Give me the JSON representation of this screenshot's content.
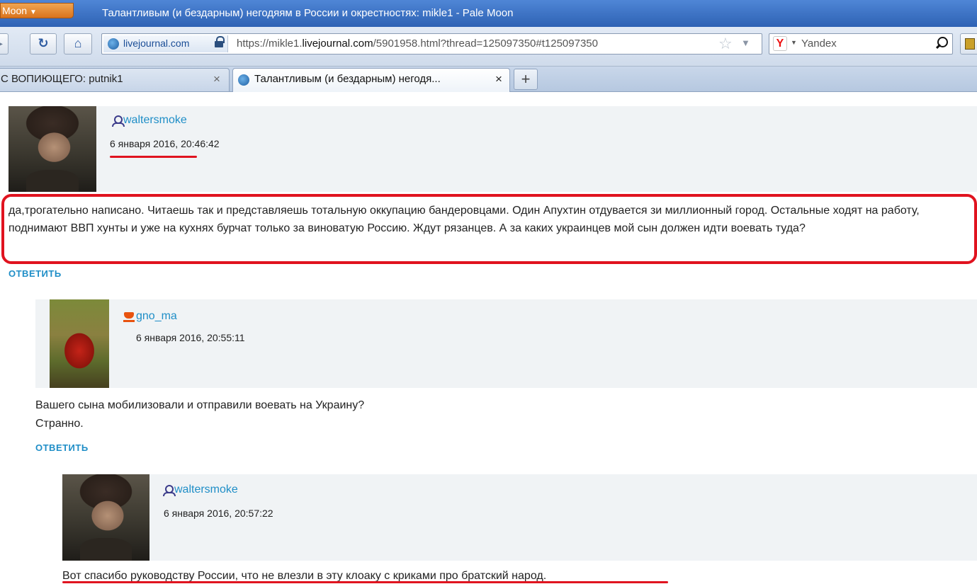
{
  "window": {
    "app_menu_label": "Moon",
    "title": "Талантливым (и бездарным) негодяям в России и окрестностях: mikle1 - Pale Moon"
  },
  "navbar": {
    "site_identity": "livejournal.com",
    "url_prefix": "https://mikle1.",
    "url_domain": "livejournal.com",
    "url_rest": "/5901958.html?thread=125097350#t125097350",
    "search_engine_placeholder": "Yandex"
  },
  "tabs": [
    {
      "label": "С ВОПИЮЩЕГО: putnik1",
      "active": false
    },
    {
      "label": "Талантливым (и бездарным) негодя...",
      "active": true
    }
  ],
  "comments": [
    {
      "username": "waltersmoke",
      "datetime": "6 января 2016, 20:46:42",
      "text": "да,трогательно написано. Читаешь так и представляешь тотальную оккупацию бандеровцами. Один Апухтин отдувается зи миллионный город. Остальные ходят на работу, поднимают ВВП хунты и уже на кухнях бурчат только за виноватую Россию. Ждут рязанцев. А за каких украинцев мой сын должен идти воевать туда?",
      "reply_label": "ОТВЕТИТЬ"
    },
    {
      "username": "gno_ma",
      "datetime": "6 января 2016, 20:55:11",
      "text_line1": "Вашего сына мобилизовали и отправили воевать на Украину?",
      "text_line2": "Странно.",
      "reply_label": "ОТВЕТИТЬ"
    },
    {
      "username": "waltersmoke",
      "datetime": "6 января 2016, 20:57:22",
      "text": "Вот спасибо руководству России, что не влезли в эту клоаку с криками про братский народ."
    }
  ],
  "annotation_color": "#e0131f"
}
